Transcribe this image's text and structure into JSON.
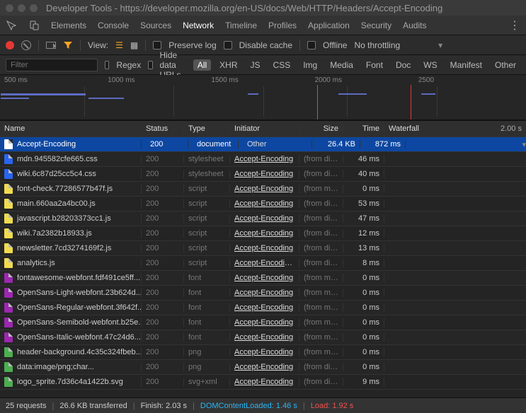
{
  "window": {
    "title": "Developer Tools - https://developer.mozilla.org/en-US/docs/Web/HTTP/Headers/Accept-Encoding"
  },
  "tabs": [
    "Elements",
    "Console",
    "Sources",
    "Network",
    "Timeline",
    "Profiles",
    "Application",
    "Security",
    "Audits"
  ],
  "active_tab": "Network",
  "toolbar": {
    "view_label": "View:",
    "preserve_log": "Preserve log",
    "disable_cache": "Disable cache",
    "offline": "Offline",
    "throttling": "No throttling"
  },
  "filterbar": {
    "placeholder": "Filter",
    "regex": "Regex",
    "hide_data_urls": "Hide data URLs",
    "chips": [
      "All",
      "XHR",
      "JS",
      "CSS",
      "Img",
      "Media",
      "Font",
      "Doc",
      "WS",
      "Manifest",
      "Other"
    ],
    "active_chip": "All"
  },
  "timeline_labels": [
    "500 ms",
    "1000 ms",
    "1500 ms",
    "2000 ms",
    "2500"
  ],
  "columns": {
    "name": "Name",
    "status": "Status",
    "type": "Type",
    "initiator": "Initiator",
    "size": "Size",
    "time": "Time",
    "waterfall": "Waterfall",
    "wend": "2.00 s"
  },
  "rows": [
    {
      "name": "Accept-Encoding",
      "status": "200",
      "type": "document",
      "icon": "doc",
      "init": "Other",
      "init_link": false,
      "size": "26.4 KB",
      "size_dim": false,
      "time": "872 ms",
      "selected": true,
      "bar": {
        "segs": [
          [
            "p",
            2,
            10
          ],
          [
            "o",
            12,
            10
          ],
          [
            "g",
            22,
            35
          ],
          [
            "b",
            57,
            22
          ]
        ]
      }
    },
    {
      "name": "mdn.945582cfe665.css",
      "status": "200",
      "type": "stylesheet",
      "icon": "css",
      "init": "Accept-Encoding",
      "init_link": true,
      "size": "(from dis...",
      "size_dim": true,
      "time": "46 ms",
      "tick": 82
    },
    {
      "name": "wiki.6c87d25cc5c4.css",
      "status": "200",
      "type": "stylesheet",
      "icon": "css",
      "init": "Accept-Encoding",
      "init_link": true,
      "size": "(from dis...",
      "size_dim": true,
      "time": "40 ms",
      "tick": 82
    },
    {
      "name": "font-check.77286577b47f.js",
      "status": "200",
      "type": "script",
      "icon": "js",
      "init": "Accept-Encoding",
      "init_link": true,
      "size": "(from me...",
      "size_dim": true,
      "time": "0 ms",
      "tick": 79
    },
    {
      "name": "main.660aa2a4bc00.js",
      "status": "200",
      "type": "script",
      "icon": "js",
      "init": "Accept-Encoding",
      "init_link": true,
      "size": "(from dis...",
      "size_dim": true,
      "time": "53 ms",
      "tick": 80
    },
    {
      "name": "javascript.b28203373cc1.js",
      "status": "200",
      "type": "script",
      "icon": "js",
      "init": "Accept-Encoding",
      "init_link": true,
      "size": "(from dis...",
      "size_dim": true,
      "time": "47 ms",
      "tick": 79
    },
    {
      "name": "wiki.7a2382b18933.js",
      "status": "200",
      "type": "script",
      "icon": "js",
      "init": "Accept-Encoding",
      "init_link": true,
      "size": "(from dis...",
      "size_dim": true,
      "time": "12 ms",
      "tick": 82
    },
    {
      "name": "newsletter.7cd3274169f2.js",
      "status": "200",
      "type": "script",
      "icon": "js",
      "init": "Accept-Encoding",
      "init_link": true,
      "size": "(from dis...",
      "size_dim": true,
      "time": "13 ms",
      "tick": 86
    },
    {
      "name": "analytics.js",
      "status": "200",
      "type": "script",
      "icon": "js",
      "init": "Accept-Encoding...",
      "init_link": true,
      "size": "(from dis...",
      "size_dim": true,
      "time": "8 ms",
      "tick": 108
    },
    {
      "name": "fontawesome-webfont.fdf491ce5ff...",
      "status": "200",
      "type": "font",
      "icon": "font",
      "init": "Accept-Encoding",
      "init_link": true,
      "size": "(from me...",
      "size_dim": true,
      "time": "0 ms",
      "tick": 113
    },
    {
      "name": "OpenSans-Light-webfont.23b624d...",
      "status": "200",
      "type": "font",
      "icon": "font",
      "init": "Accept-Encoding",
      "init_link": true,
      "size": "(from me...",
      "size_dim": true,
      "time": "0 ms",
      "tick": 113
    },
    {
      "name": "OpenSans-Regular-webfont.3f642f...",
      "status": "200",
      "type": "font",
      "icon": "font",
      "init": "Accept-Encoding",
      "init_link": true,
      "size": "(from me...",
      "size_dim": true,
      "time": "0 ms",
      "tick": 113
    },
    {
      "name": "OpenSans-Semibold-webfont.b25e...",
      "status": "200",
      "type": "font",
      "icon": "font",
      "init": "Accept-Encoding",
      "init_link": true,
      "size": "(from me...",
      "size_dim": true,
      "time": "0 ms",
      "tick": 113
    },
    {
      "name": "OpenSans-Italic-webfont.47c24d6...",
      "status": "200",
      "type": "font",
      "icon": "font",
      "init": "Accept-Encoding",
      "init_link": true,
      "size": "(from me...",
      "size_dim": true,
      "time": "0 ms",
      "tick": 113
    },
    {
      "name": "header-background.4c35c324fbeb...",
      "status": "200",
      "type": "png",
      "icon": "img",
      "init": "Accept-Encoding",
      "init_link": true,
      "size": "(from me...",
      "size_dim": true,
      "time": "0 ms",
      "tick": 113
    },
    {
      "name": "data:image/png;char...",
      "status": "200",
      "type": "png",
      "icon": "img",
      "init": "Accept-Encoding",
      "init_link": true,
      "size": "(from dis...",
      "size_dim": true,
      "time": "0 ms",
      "tick": 113
    },
    {
      "name": "logo_sprite.7d36c4a1422b.svg",
      "status": "200",
      "type": "svg+xml",
      "icon": "img",
      "init": "Accept-Encoding",
      "init_link": true,
      "size": "(from dis...",
      "size_dim": true,
      "time": "9 ms",
      "tick": 113
    }
  ],
  "status": {
    "requests": "25 requests",
    "transferred": "26.6 KB transferred",
    "finish": "Finish: 2.03 s",
    "dcl_label": "DOMContentLoaded:",
    "dcl_value": "1.46 s",
    "load_label": "Load:",
    "load_value": "1.92 s"
  }
}
